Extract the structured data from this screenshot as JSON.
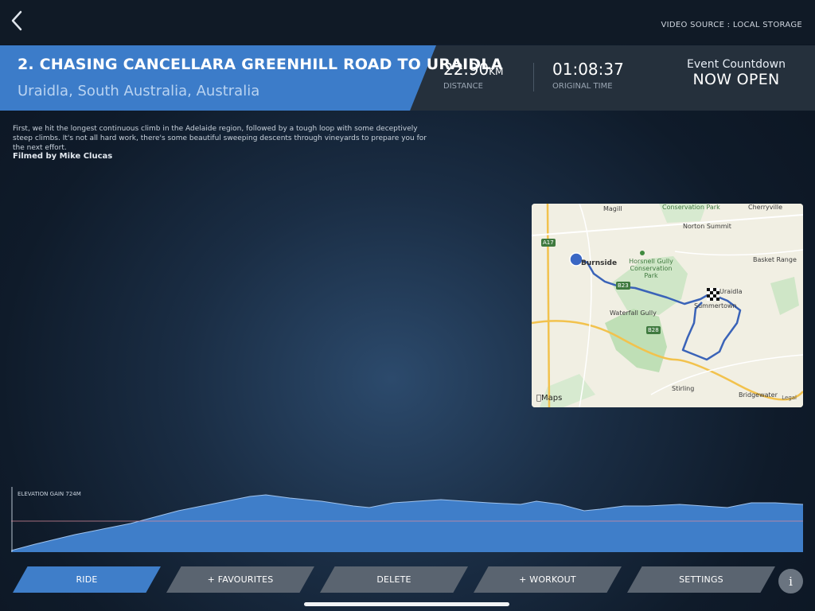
{
  "topbar": {
    "back_icon": "chevron-left-icon",
    "video_source": "VIDEO SOURCE : LOCAL STORAGE"
  },
  "ride": {
    "title": "2. CHASING CANCELLARA GREENHILL ROAD TO URAIDLA",
    "location": "Uraidla, South Australia, Australia"
  },
  "stats": {
    "distance_value": "22.90",
    "distance_unit": "KM",
    "distance_label": "DISTANCE",
    "time_value": "01:08:37",
    "time_label": "ORIGINAL TIME"
  },
  "countdown": {
    "label": "Event Countdown",
    "status": "NOW OPEN"
  },
  "description": {
    "text": "First, we hit the longest continuous climb in the Adelaide region, followed by a tough loop with some deceptively steep climbs. It's not all hard work, there's some beautiful sweeping descents through vineyards to prepare you for the next effort.",
    "filmed_by": "Filmed by Mike Clucas"
  },
  "map": {
    "labels": {
      "magill": "Magill",
      "conservation_park_top": "Conservation Park",
      "norton_summit": "Norton Summit",
      "cherryville": "Cherryville",
      "a17": "A17",
      "burnside": "Burnside",
      "horsnell": "Horsnell Gully Conservation Park",
      "basket_range": "Basket Range",
      "b23": "B23",
      "uraidla": "Uraidla",
      "summertown": "Summertown",
      "waterfall_gully": "Waterfall Gully",
      "b28": "B28",
      "stirling": "Stirling",
      "bridgewater": "Bridgewater",
      "maps_brand": "Maps",
      "legal": "Legal"
    },
    "route_color": "#3a63b8"
  },
  "elevation": {
    "label": "ELEVATION GAIN 724M",
    "fill_color": "#3f7ec9"
  },
  "buttons": {
    "ride": "RIDE",
    "favourites": "+ FAVOURITES",
    "delete": "DELETE",
    "workout": "+ WORKOUT",
    "settings": "SETTINGS",
    "info": "i"
  },
  "colors": {
    "accent": "#3f7ec9",
    "header_dark": "#25303c",
    "button": "#5a6470"
  }
}
